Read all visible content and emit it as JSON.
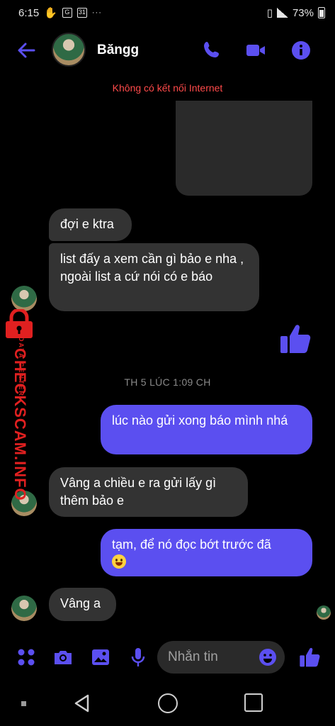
{
  "status_bar": {
    "time": "6:15",
    "battery": "73%",
    "calendar_day": "31",
    "g_label": "G"
  },
  "header": {
    "contact_name": "Băngg"
  },
  "banner": {
    "offline_text": "Không có kết nối Internet"
  },
  "messages": [
    {
      "text": "đợi e ktra"
    },
    {
      "text": "list đấy a xem cần gì bảo e nha  , ngoài list a cứ nói có e báo"
    },
    {
      "text": "lúc nào gửi xong báo mình nhá"
    },
    {
      "text": "Vâng a chiều e ra gửi lấy gì thêm bảo e"
    },
    {
      "text": "tạm, để nó đọc bớt trước đã"
    },
    {
      "text": "Vâng a"
    }
  ],
  "timestamp": "TH 5 LÚC 1:09 CH",
  "composer": {
    "placeholder": "Nhắn tin"
  },
  "watermark": {
    "title": "CHECKSCAM.INFO",
    "subtitle": "DATA CENTER"
  },
  "colors": {
    "accent": "#5b4ff0",
    "incoming_bubble": "#333333",
    "warning": "#ff4a4a",
    "watermark": "#e02020"
  },
  "icons": [
    "back-arrow-icon",
    "phone-icon",
    "video-camera-icon",
    "info-icon",
    "thumbs-up-icon",
    "grid-dots-icon",
    "camera-icon",
    "image-icon",
    "microphone-icon",
    "emoji-icon",
    "lock-icon"
  ]
}
